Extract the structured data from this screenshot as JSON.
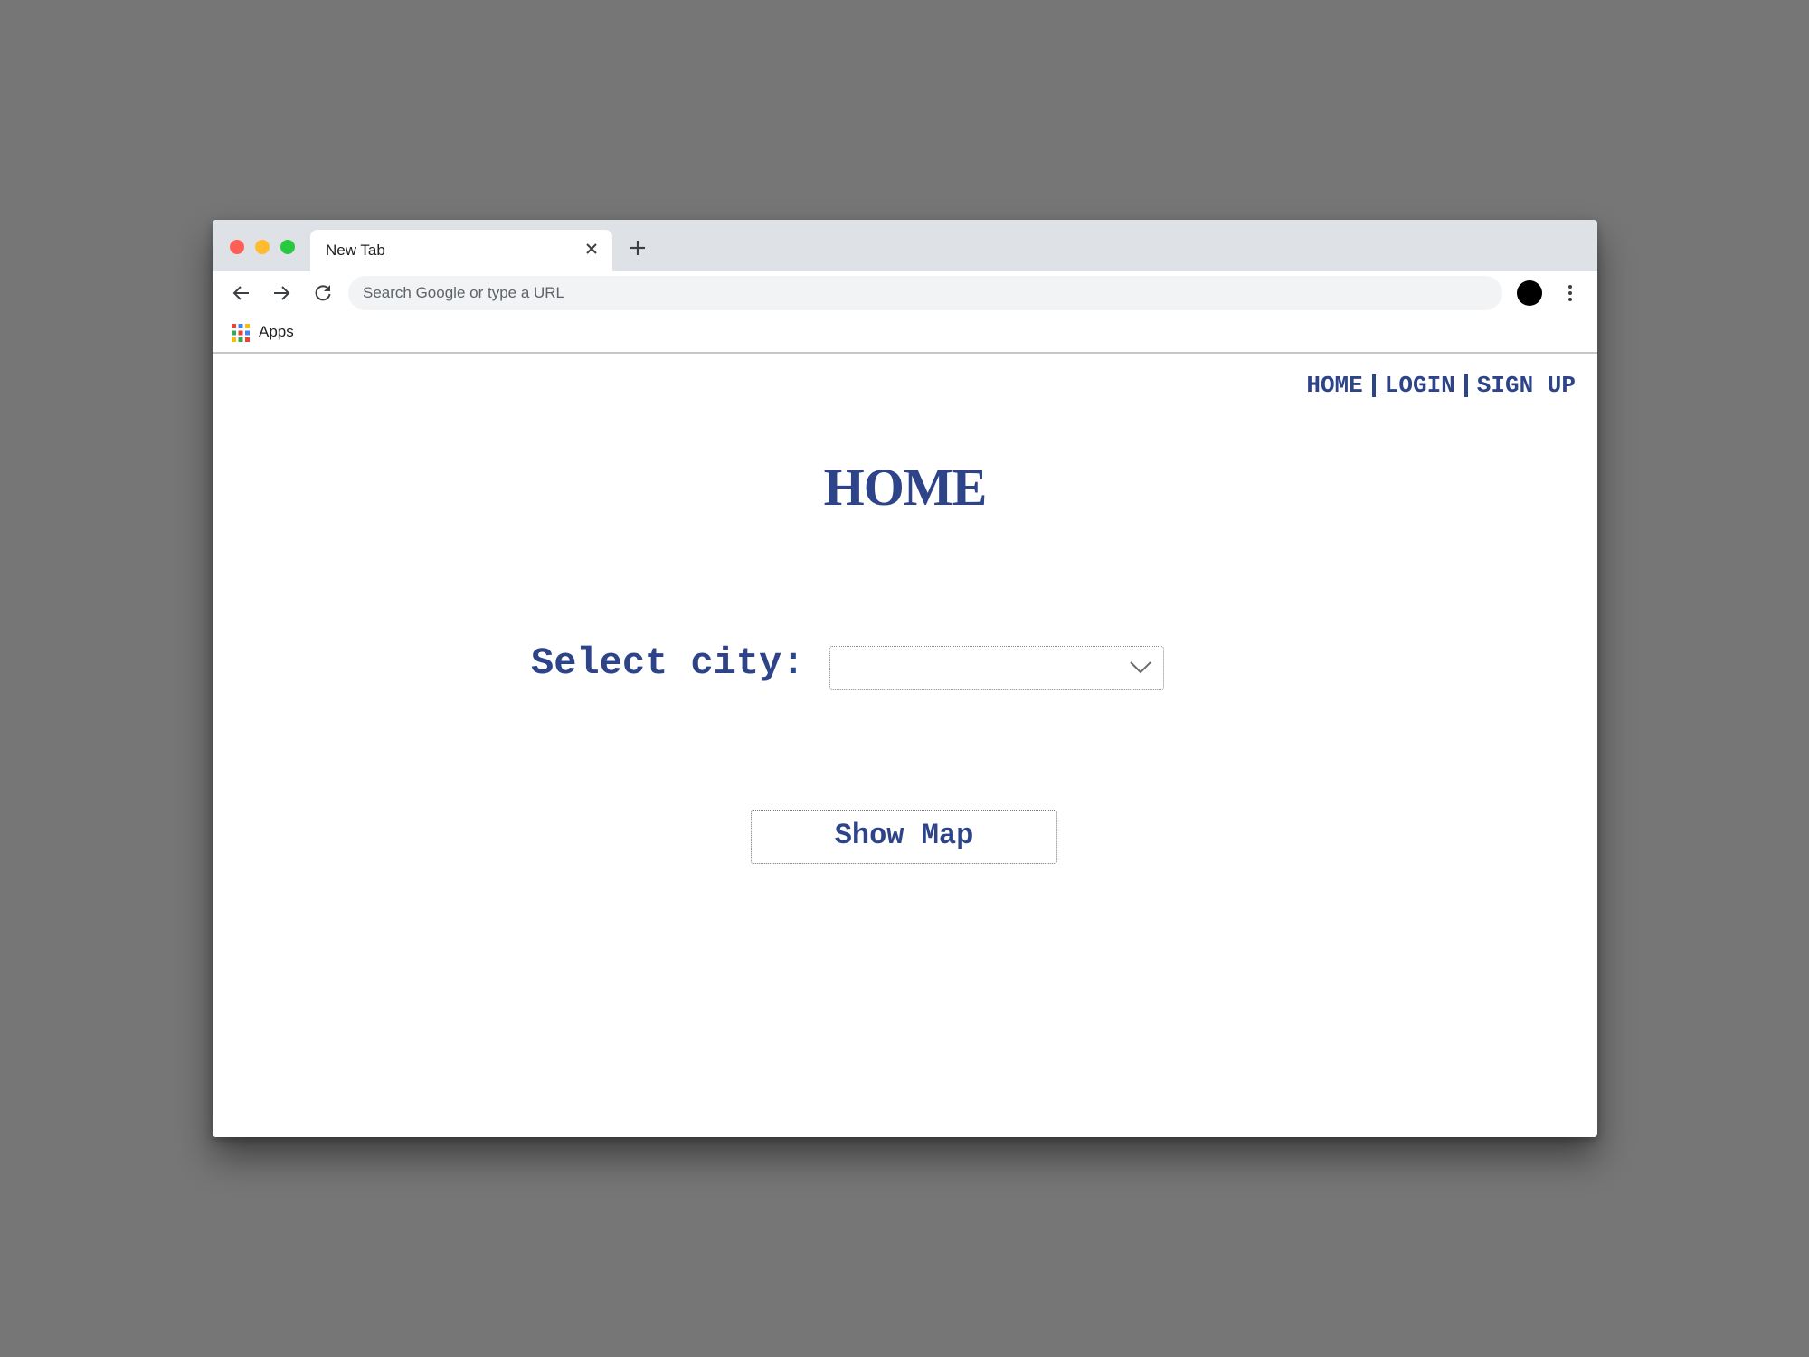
{
  "browser": {
    "tab": {
      "title": "New Tab"
    },
    "omnibox": {
      "placeholder": "Search Google or type a URL",
      "value": ""
    },
    "bookmarks": {
      "apps_label": "Apps"
    },
    "icons": {
      "close": "close-icon",
      "new_tab": "plus-icon",
      "back": "arrow-left-icon",
      "forward": "arrow-right-icon",
      "reload": "reload-icon",
      "avatar": "profile-avatar",
      "menu": "kebab-menu-icon",
      "apps": "apps-grid-icon"
    }
  },
  "page": {
    "nav": {
      "home": "HOME",
      "login": "LOGIN",
      "signup": "SIGN UP"
    },
    "title": "HOME",
    "city_label": "Select city:",
    "city_select_value": "",
    "show_map_label": "Show Map"
  },
  "colors": {
    "accent": "#2e4489",
    "backdrop": "#767676",
    "tab_strip": "#dee1e6"
  }
}
